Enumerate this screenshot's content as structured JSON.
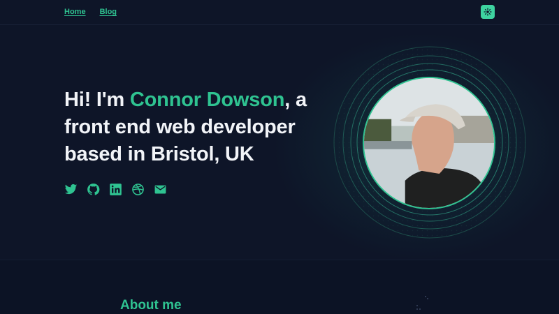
{
  "nav": {
    "items": [
      {
        "label": "Home"
      },
      {
        "label": "Blog"
      }
    ]
  },
  "theme_toggle": {
    "icon": "sun-icon",
    "color": "#3ed3a0"
  },
  "hero": {
    "greeting_prefix": "Hi! I'm ",
    "name": "Connor Dowson",
    "greeting_suffix": ", a front end web developer based in Bristol, UK"
  },
  "socials": [
    {
      "icon": "twitter-icon"
    },
    {
      "icon": "github-icon"
    },
    {
      "icon": "linkedin-icon"
    },
    {
      "icon": "dribbble-icon"
    },
    {
      "icon": "email-icon"
    }
  ],
  "about": {
    "heading": "About me"
  },
  "colors": {
    "background": "#0e1528",
    "accent": "#2fc391",
    "heading_text": "#f2f4f8"
  }
}
